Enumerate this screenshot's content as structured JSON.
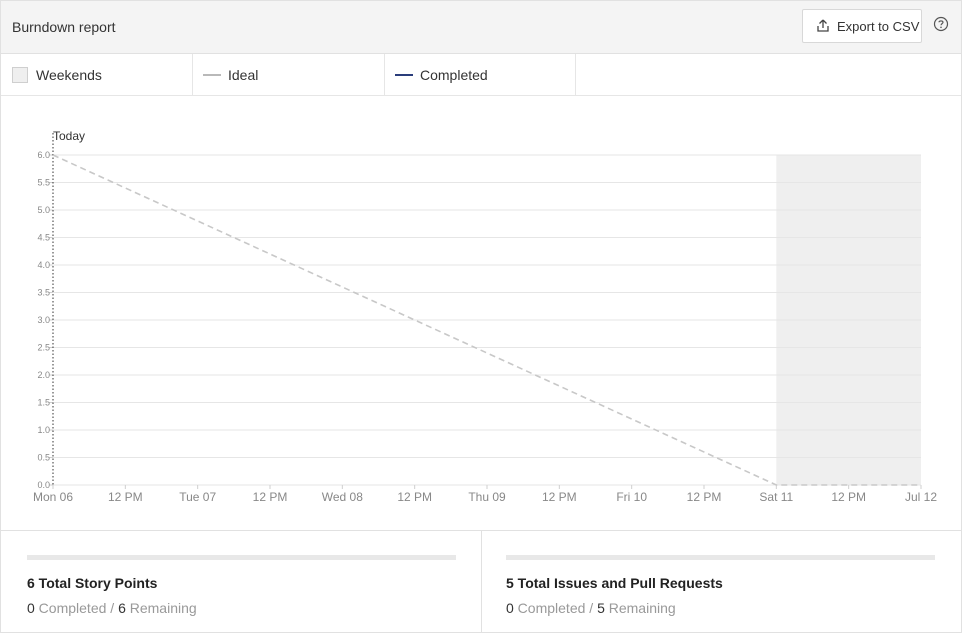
{
  "header": {
    "title": "Burndown report",
    "export_label": "Export to CSV"
  },
  "legend": [
    {
      "label": "Weekends",
      "kind": "box"
    },
    {
      "label": "Ideal",
      "kind": "line",
      "color": "#b9b9b9"
    },
    {
      "label": "Completed",
      "kind": "line",
      "color": "#2a3d7b"
    }
  ],
  "chart_data": {
    "type": "line",
    "today_label": "Today",
    "x_tick_labels": [
      "Mon 06",
      "12 PM",
      "Tue 07",
      "12 PM",
      "Wed 08",
      "12 PM",
      "Thu 09",
      "12 PM",
      "Fri 10",
      "12 PM",
      "Sat 11",
      "12 PM",
      "Jul 12"
    ],
    "y_ticks": [
      "0.0",
      "0.5",
      "1.0",
      "1.5",
      "2.0",
      "2.5",
      "3.0",
      "3.5",
      "4.0",
      "4.5",
      "5.0",
      "5.5",
      "6.0"
    ],
    "ylim": [
      0,
      6
    ],
    "xlim": [
      "Mon 06",
      "Jul 12"
    ],
    "weekend": {
      "from": "Sat 11",
      "to": "Jul 12"
    },
    "series": [
      {
        "name": "Ideal",
        "style": "dashed",
        "color": "#c8c8c8",
        "points": [
          {
            "x": "Mon 06",
            "y": 6
          },
          {
            "x": "Sat 11",
            "y": 0
          },
          {
            "x": "Jul 12",
            "y": 0
          }
        ]
      }
    ],
    "grid": true
  },
  "stats": [
    {
      "title": "6 Total Story Points",
      "completed": "0",
      "completed_label": " Completed / ",
      "remaining": "6",
      "remaining_label": " Remaining",
      "progress": 0
    },
    {
      "title": "5 Total Issues and Pull Requests",
      "completed": "0",
      "completed_label": " Completed / ",
      "remaining": "5",
      "remaining_label": " Remaining",
      "progress": 0
    }
  ]
}
